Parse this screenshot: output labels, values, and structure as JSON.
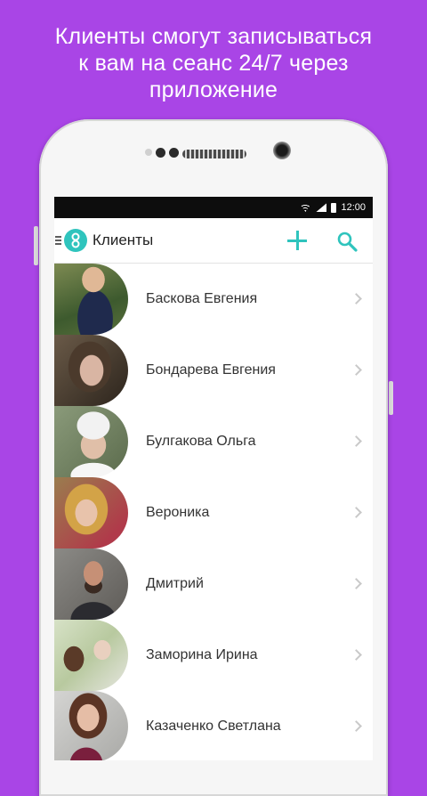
{
  "promo": {
    "line1": "Клиенты смогут записываться",
    "line2": "к вам на сеанс 24/7 через",
    "line3": "приложение"
  },
  "colors": {
    "background": "#a945e6",
    "accent": "#2fc4bd"
  },
  "statusbar": {
    "time": "12:00"
  },
  "toolbar": {
    "title": "Клиенты",
    "icons": [
      "menu-icon",
      "app-logo",
      "add-icon",
      "search-icon"
    ]
  },
  "clients": [
    {
      "name": "Баскова Евгения"
    },
    {
      "name": "Бондарева Евгения"
    },
    {
      "name": "Булгакова Ольга"
    },
    {
      "name": "Вероника"
    },
    {
      "name": "Дмитрий"
    },
    {
      "name": "Заморина Ирина"
    },
    {
      "name": "Казаченко Светлана"
    }
  ]
}
